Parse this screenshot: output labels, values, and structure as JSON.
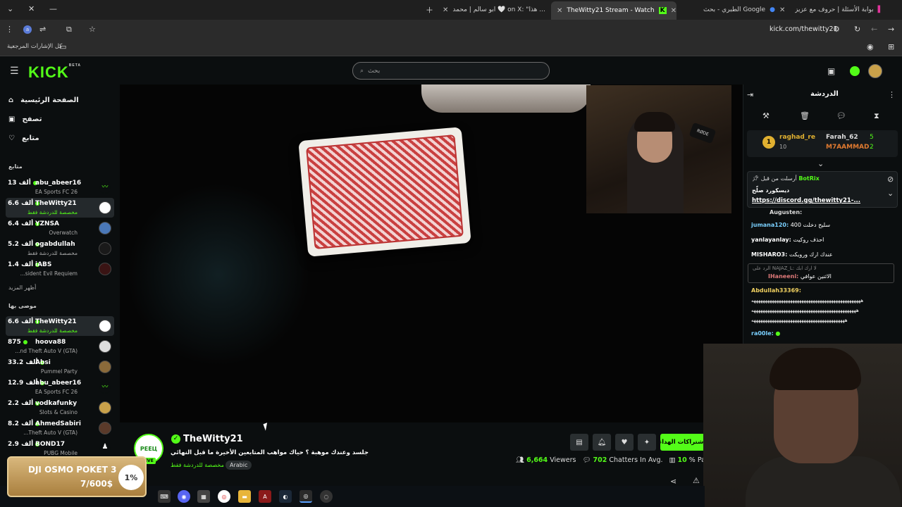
{
  "browser": {
    "tabs": [
      {
        "title": "بوابة الأسئلة | حروف مع عزيز",
        "active": false
      },
      {
        "title": "الطبري - بحث Google",
        "active": false
      },
      {
        "title": "TheWitty21 Stream - Watch",
        "active": true
      },
      {
        "title": "ابو سالم | محمد 🤍 on X: \"هذا ...",
        "active": false
      }
    ],
    "url": "kick.com/thewitty21",
    "bookmarks_label": "كل الإشارات المرجعية"
  },
  "header": {
    "logo": "KICK",
    "logo_badge": "BETA",
    "search_placeholder": "بحث"
  },
  "sidebar": {
    "nav": [
      {
        "label": "الصفحة الرئيسية",
        "icon": "home-icon"
      },
      {
        "label": "تصفح",
        "icon": "browse-icon"
      },
      {
        "label": "متابع",
        "icon": "heart-icon"
      }
    ],
    "following_title": "متابع",
    "following": [
      {
        "viewers": "13 ألف",
        "name": "abu_abeer16",
        "category": "EA Sports FC 26"
      },
      {
        "viewers": "6.6 ألف",
        "name": "TheWitty21",
        "category": "مخصصة للدردشة فقط"
      },
      {
        "viewers": "6.4 ألف",
        "name": "YZNSA",
        "category": "Overwatch"
      },
      {
        "viewers": "5.2 ألف",
        "name": "ogabdullah",
        "category": "مخصصة للدردشة فقط"
      },
      {
        "viewers": "1.4 ألف",
        "name": "iABS",
        "category": "...sident Evil Requiem"
      }
    ],
    "show_more": "أظهر المزيد",
    "recommended_title": "موصى بها",
    "recommended": [
      {
        "viewers": "6.6 ألف",
        "name": "TheWitty21",
        "category": "مخصصة للدردشة فقط"
      },
      {
        "viewers": "875",
        "name": "hoova88",
        "category": "...nd Theft Auto V (GTA)"
      },
      {
        "viewers": "33.2 ألف",
        "name": "Absi",
        "category": "Pummel Party"
      },
      {
        "viewers": "12.9 ألف",
        "name": "abu_abeer16",
        "category": "EA Sports FC 26"
      },
      {
        "viewers": "2.2 ألف",
        "name": "vodkafunky",
        "category": "Slots & Casino"
      },
      {
        "viewers": "8.2 ألف",
        "name": "AhmedSabiri",
        "category": "...Theft Auto V (GTA)"
      },
      {
        "viewers": "2.9 ألف",
        "name": "BOND17",
        "category": "PUBG Mobile"
      }
    ]
  },
  "video": {
    "cam_mic_label": "RØDE"
  },
  "stream": {
    "avatar_text": "PEEЦ",
    "live_badge": "LIVE",
    "name": "TheWitty21",
    "title": "جلسد وعندك موهبة ؟ حياك مواهب المتابعين الأخيرة ما قبل النهائي",
    "category": "مخصصة للدردشة فقط",
    "language": "Arabic",
    "subscribe_label": "اشتراكات الهداء",
    "viewers": "6,664",
    "viewers_label": "Viewers",
    "chatters": "702",
    "chatters_label": "Chatters In Avg.",
    "partial": "10",
    "partial_label": "% Parti"
  },
  "chat": {
    "title": "الدردشة",
    "leaderboard": [
      {
        "rank": "1",
        "name": "raghad_re",
        "count": "10"
      },
      {
        "name": "Farah_62",
        "count": "5"
      },
      {
        "name": "M7AAMMAD",
        "count": "2"
      }
    ],
    "pinned": {
      "header": "أرسلت من قبل",
      "author": "BotRix",
      "text": "ديسكورد صلّح",
      "link": "https://discord.gg/thewitty21-..."
    },
    "messages": [
      {
        "user": "Augusten:",
        "text": ""
      },
      {
        "user": "jumana120:",
        "text": "سليح دخلت 400"
      },
      {
        "user": "yanlayanlay:",
        "text": "احذف روكيت"
      },
      {
        "user": "MISHARO3:",
        "text": "عندك ارك ورويكت"
      },
      {
        "user": "IHaneeni:",
        "text": "الاثنين عوافي",
        "reply": "الرد على NAJAZ_L: لا ارك ابك"
      },
      {
        "user": "Abdullah33369:",
        "text": ""
      },
      {
        "user": "",
        "text": "ههههههههههههههههههههههههههههههههههههههههههههههههه"
      },
      {
        "user": "",
        "text": "ههههههههههههههههههههههههههههههههههههههههههههههه"
      },
      {
        "user": "",
        "text": "هههههههههههههههههههههههههههههههههههههههههه"
      },
      {
        "user": "ra00le:",
        "text": ""
      }
    ]
  },
  "goal": {
    "title": "DJI OSMO POKET 3",
    "progress": "7/600$",
    "percent": "1%"
  },
  "colors": {
    "accent": "#53fc18",
    "background": "#0b0e0f",
    "goal": "#c79a55"
  }
}
